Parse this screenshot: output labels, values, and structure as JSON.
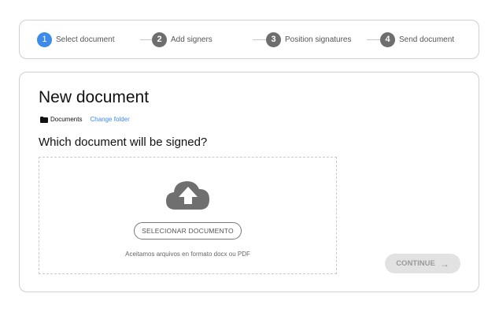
{
  "stepper": {
    "steps": [
      {
        "number": "1",
        "label": "Select document",
        "active": true
      },
      {
        "number": "2",
        "label": "Add signers",
        "active": false
      },
      {
        "number": "3",
        "label": "Position signatures",
        "active": false
      },
      {
        "number": "4",
        "label": "Send document",
        "active": false
      }
    ]
  },
  "page": {
    "title": "New document",
    "folder": {
      "icon": "folder-icon",
      "name": "Documents",
      "change_label": "Change folder"
    },
    "question": "Which document will be signed?"
  },
  "dropzone": {
    "icon": "cloud-upload-icon",
    "select_button": "SELECIONAR DOCUMENTO",
    "note": "Aceitamos arquivos en formato docx ou PDF"
  },
  "continue_button": {
    "label": "CONTINUE",
    "icon": "arrow-right-icon",
    "enabled": false
  },
  "colors": {
    "accent": "#3d8be8",
    "step_inactive": "#6e6e6e",
    "border": "#cfcfcf",
    "disabled_button": "#e2e2e2"
  }
}
